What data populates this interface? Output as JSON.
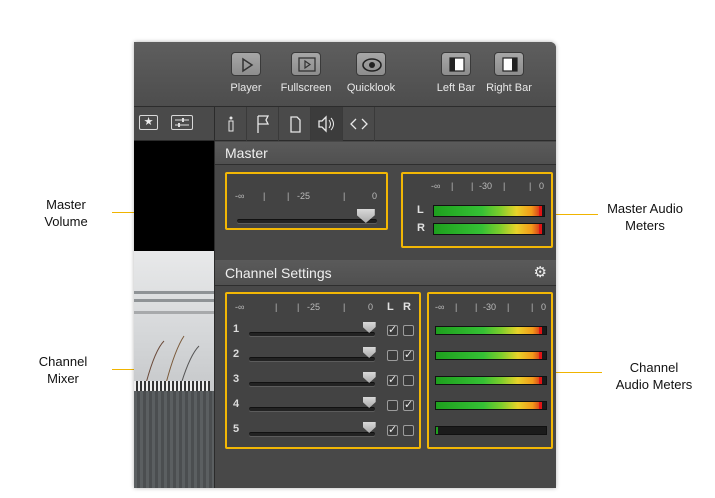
{
  "annotations": {
    "master_volume": "Master\nVolume",
    "master_audio_meters": "Master Audio\nMeters",
    "channel_mixer": "Channel\nMixer",
    "channel_audio_meters": "Channel\nAudio Meters"
  },
  "toolbar": {
    "player_label": "Player",
    "fullscreen_label": "Fullscreen",
    "quicklook_label": "Quicklook",
    "left_bar_label": "Left Bar",
    "right_bar_label": "Right Bar"
  },
  "tabs": [
    {
      "icon": "info-icon",
      "glyph": "ℹ"
    },
    {
      "icon": "flag-icon",
      "glyph": "⚐"
    },
    {
      "icon": "document-icon",
      "glyph": "▯"
    },
    {
      "icon": "speaker-icon",
      "glyph": "◁))"
    },
    {
      "icon": "code-icon",
      "glyph": "<>"
    }
  ],
  "master": {
    "title": "Master",
    "volume_scale": {
      "min": "-∞",
      "mid": "-25",
      "max": "0"
    },
    "volume_level": 0.92,
    "meter_scale": {
      "min": "-∞",
      "mid": "-30",
      "max": "0"
    },
    "meters": [
      {
        "label": "L",
        "level": 0.96
      },
      {
        "label": "R",
        "level": 0.96
      }
    ]
  },
  "channel_settings": {
    "title": "Channel Settings",
    "mixer_scale": {
      "min": "-∞",
      "mid": "-25",
      "max": "0",
      "l": "L",
      "r": "R"
    },
    "meter_scale": {
      "min": "-∞",
      "mid": "-30",
      "max": "0"
    },
    "channels": [
      {
        "num": "1",
        "level": 0.95,
        "left": true,
        "right": false,
        "meter": 0.95
      },
      {
        "num": "2",
        "level": 0.95,
        "left": false,
        "right": true,
        "meter": 0.95
      },
      {
        "num": "3",
        "level": 0.95,
        "left": true,
        "right": false,
        "meter": 0.95
      },
      {
        "num": "4",
        "level": 0.95,
        "left": false,
        "right": true,
        "meter": 0.95
      },
      {
        "num": "5",
        "level": 0.95,
        "left": true,
        "right": false,
        "meter": 0.02
      }
    ]
  },
  "colors": {
    "highlight": "#f2b705",
    "window_bg": "#4a4a4a"
  }
}
